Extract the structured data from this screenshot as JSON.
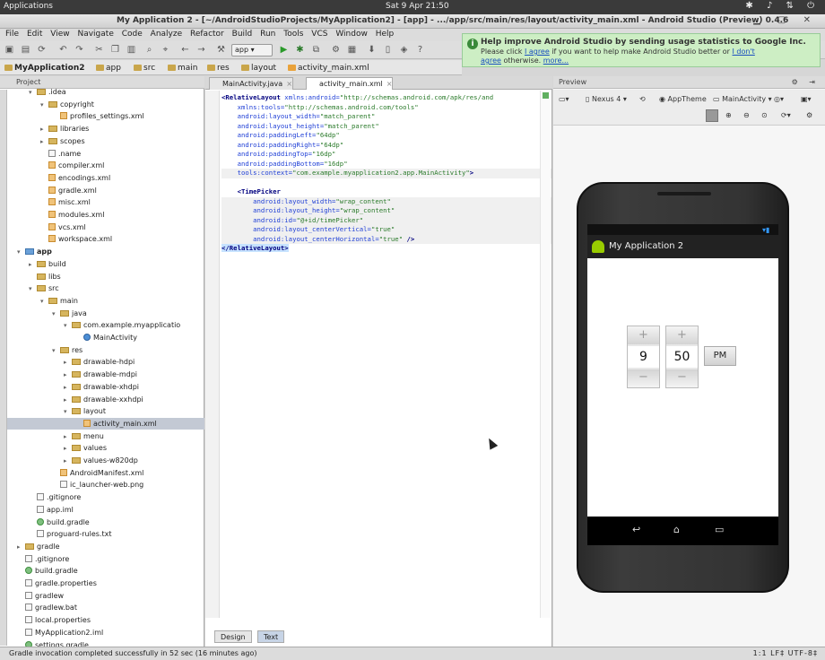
{
  "system": {
    "apps_label": "Applications",
    "clock": "Sat 9 Apr 21:50",
    "icons": [
      "bluetooth-icon",
      "volume-icon",
      "network-icon",
      "power-icon"
    ]
  },
  "window": {
    "title": "My Application 2 - [~/AndroidStudioProjects/MyApplication2] - [app] - .../app/src/main/res/layout/activity_main.xml - Android Studio (Preview) 0.4.6"
  },
  "menu": [
    "File",
    "Edit",
    "View",
    "Navigate",
    "Code",
    "Analyze",
    "Refactor",
    "Build",
    "Run",
    "Tools",
    "VCS",
    "Window",
    "Help"
  ],
  "toolbar": {
    "run_config": "app"
  },
  "notification": {
    "title": "Help improve Android Studio by sending usage statistics to Google Inc.",
    "line2_prefix": "Please click",
    "agree": "I agree",
    "line2_suffix": "if you want to help make Android Studio better or",
    "dont_agree": "I don't",
    "agree2": "agree",
    "line3_mid": "otherwise.",
    "more": "more..."
  },
  "breadcrumbs": [
    "MyApplication2",
    "app",
    "src",
    "main",
    "res",
    "layout",
    "activity_main.xml"
  ],
  "project_panel": {
    "header": "Project"
  },
  "tree": [
    {
      "label": ".idea",
      "depth": 2,
      "arrow": "▾",
      "type": "folder"
    },
    {
      "label": "copyright",
      "depth": 3,
      "arrow": "▾",
      "type": "folder"
    },
    {
      "label": "profiles_settings.xml",
      "depth": 4,
      "arrow": "",
      "type": "xml"
    },
    {
      "label": "libraries",
      "depth": 3,
      "arrow": "▸",
      "type": "folder"
    },
    {
      "label": "scopes",
      "depth": 3,
      "arrow": "▸",
      "type": "folder"
    },
    {
      "label": ".name",
      "depth": 3,
      "arrow": "",
      "type": "file"
    },
    {
      "label": "compiler.xml",
      "depth": 3,
      "arrow": "",
      "type": "xml"
    },
    {
      "label": "encodings.xml",
      "depth": 3,
      "arrow": "",
      "type": "xml"
    },
    {
      "label": "gradle.xml",
      "depth": 3,
      "arrow": "",
      "type": "xml"
    },
    {
      "label": "misc.xml",
      "depth": 3,
      "arrow": "",
      "type": "xml"
    },
    {
      "label": "modules.xml",
      "depth": 3,
      "arrow": "",
      "type": "xml"
    },
    {
      "label": "vcs.xml",
      "depth": 3,
      "arrow": "",
      "type": "xml"
    },
    {
      "label": "workspace.xml",
      "depth": 3,
      "arrow": "",
      "type": "xml"
    },
    {
      "label": "app",
      "depth": 1,
      "arrow": "▾",
      "type": "module"
    },
    {
      "label": "build",
      "depth": 2,
      "arrow": "▸",
      "type": "folder"
    },
    {
      "label": "libs",
      "depth": 2,
      "arrow": "",
      "type": "folder"
    },
    {
      "label": "src",
      "depth": 2,
      "arrow": "▾",
      "type": "folder"
    },
    {
      "label": "main",
      "depth": 3,
      "arrow": "▾",
      "type": "folder"
    },
    {
      "label": "java",
      "depth": 4,
      "arrow": "▾",
      "type": "folder"
    },
    {
      "label": "com.example.myapplicatio",
      "depth": 5,
      "arrow": "▾",
      "type": "folder"
    },
    {
      "label": "MainActivity",
      "depth": 6,
      "arrow": "",
      "type": "class"
    },
    {
      "label": "res",
      "depth": 4,
      "arrow": "▾",
      "type": "folder"
    },
    {
      "label": "drawable-hdpi",
      "depth": 5,
      "arrow": "▸",
      "type": "folder"
    },
    {
      "label": "drawable-mdpi",
      "depth": 5,
      "arrow": "▸",
      "type": "folder"
    },
    {
      "label": "drawable-xhdpi",
      "depth": 5,
      "arrow": "▸",
      "type": "folder"
    },
    {
      "label": "drawable-xxhdpi",
      "depth": 5,
      "arrow": "▸",
      "type": "folder"
    },
    {
      "label": "layout",
      "depth": 5,
      "arrow": "▾",
      "type": "folder"
    },
    {
      "label": "activity_main.xml",
      "depth": 6,
      "arrow": "",
      "type": "xml",
      "selected": true
    },
    {
      "label": "menu",
      "depth": 5,
      "arrow": "▸",
      "type": "folder"
    },
    {
      "label": "values",
      "depth": 5,
      "arrow": "▸",
      "type": "folder"
    },
    {
      "label": "values-w820dp",
      "depth": 5,
      "arrow": "▸",
      "type": "folder"
    },
    {
      "label": "AndroidManifest.xml",
      "depth": 4,
      "arrow": "",
      "type": "xml"
    },
    {
      "label": "ic_launcher-web.png",
      "depth": 4,
      "arrow": "",
      "type": "file"
    },
    {
      "label": ".gitignore",
      "depth": 2,
      "arrow": "",
      "type": "file"
    },
    {
      "label": "app.iml",
      "depth": 2,
      "arrow": "",
      "type": "file"
    },
    {
      "label": "build.gradle",
      "depth": 2,
      "arrow": "",
      "type": "gradle"
    },
    {
      "label": "proguard-rules.txt",
      "depth": 2,
      "arrow": "",
      "type": "file"
    },
    {
      "label": "gradle",
      "depth": 1,
      "arrow": "▸",
      "type": "folder"
    },
    {
      "label": ".gitignore",
      "depth": 1,
      "arrow": "",
      "type": "file"
    },
    {
      "label": "build.gradle",
      "depth": 1,
      "arrow": "",
      "type": "gradle"
    },
    {
      "label": "gradle.properties",
      "depth": 1,
      "arrow": "",
      "type": "file"
    },
    {
      "label": "gradlew",
      "depth": 1,
      "arrow": "",
      "type": "file"
    },
    {
      "label": "gradlew.bat",
      "depth": 1,
      "arrow": "",
      "type": "file"
    },
    {
      "label": "local.properties",
      "depth": 1,
      "arrow": "",
      "type": "file"
    },
    {
      "label": "MyApplication2.iml",
      "depth": 1,
      "arrow": "",
      "type": "file"
    },
    {
      "label": "settings.gradle",
      "depth": 1,
      "arrow": "",
      "type": "gradle"
    }
  ],
  "editor": {
    "tabs": [
      {
        "label": "MainActivity.java",
        "active": false
      },
      {
        "label": "activity_main.xml",
        "active": true
      }
    ],
    "bottom_tabs": [
      {
        "label": "Design",
        "active": false
      },
      {
        "label": "Text",
        "active": true
      }
    ],
    "code_lines": [
      {
        "parts": [
          [
            "tag",
            "<RelativeLayout "
          ],
          [
            "att",
            "xmlns:android="
          ],
          [
            "val",
            "\"http://schemas.android.com/apk/res/and"
          ]
        ],
        "hl": false
      },
      {
        "parts": [
          [
            "att",
            "    xmlns:tools="
          ],
          [
            "val",
            "\"http://schemas.android.com/tools\""
          ]
        ],
        "hl": false
      },
      {
        "parts": [
          [
            "att",
            "    android:layout_width="
          ],
          [
            "val",
            "\"match_parent\""
          ]
        ],
        "hl": false
      },
      {
        "parts": [
          [
            "att",
            "    android:layout_height="
          ],
          [
            "val",
            "\"match_parent\""
          ]
        ],
        "hl": false
      },
      {
        "parts": [
          [
            "att",
            "    android:paddingLeft="
          ],
          [
            "val",
            "\"64dp\""
          ]
        ],
        "hl": false
      },
      {
        "parts": [
          [
            "att",
            "    android:paddingRight="
          ],
          [
            "val",
            "\"64dp\""
          ]
        ],
        "hl": false
      },
      {
        "parts": [
          [
            "att",
            "    android:paddingTop="
          ],
          [
            "val",
            "\"16dp\""
          ]
        ],
        "hl": false
      },
      {
        "parts": [
          [
            "att",
            "    android:paddingBottom="
          ],
          [
            "val",
            "\"16dp\""
          ]
        ],
        "hl": false
      },
      {
        "parts": [
          [
            "att",
            "    tools:context="
          ],
          [
            "val",
            "\"com.example.myapplication2.app.MainActivity\""
          ],
          [
            "tag",
            ">"
          ]
        ],
        "hl": true
      },
      {
        "parts": [
          [
            "tag",
            " "
          ]
        ],
        "hl": false
      },
      {
        "parts": [
          [
            "tag",
            "    <TimePicker"
          ]
        ],
        "hl": false
      },
      {
        "parts": [
          [
            "att",
            "        android:layout_width="
          ],
          [
            "val",
            "\"wrap_content\""
          ]
        ],
        "hl": true
      },
      {
        "parts": [
          [
            "att",
            "        android:layout_height="
          ],
          [
            "val",
            "\"wrap_content\""
          ]
        ],
        "hl": true
      },
      {
        "parts": [
          [
            "att",
            "        android:id="
          ],
          [
            "val",
            "\"@+id/timePicker\""
          ]
        ],
        "hl": true
      },
      {
        "parts": [
          [
            "att",
            "        android:layout_centerVertical="
          ],
          [
            "val",
            "\"true\""
          ]
        ],
        "hl": true
      },
      {
        "parts": [
          [
            "att",
            "        android:layout_centerHorizontal="
          ],
          [
            "val",
            "\"true\""
          ],
          [
            "tag",
            " />"
          ]
        ],
        "hl": true
      },
      {
        "parts": [
          [
            "rtag",
            "</RelativeLayout>"
          ]
        ],
        "hl": false
      }
    ]
  },
  "preview": {
    "header": "Preview",
    "device": "Nexus 4",
    "theme": "AppTheme",
    "activity": "MainActivity",
    "app_title": "My Application 2",
    "time_picker": {
      "hour": "9",
      "minute": "50",
      "ampm": "PM",
      "plus": "+",
      "minus": "−"
    }
  },
  "status": {
    "message": "Gradle invocation completed successfully in 52 sec (16 minutes ago)",
    "position": "1:1   LF‡   UTF-8‡"
  }
}
